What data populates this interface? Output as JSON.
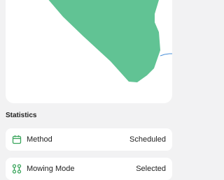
{
  "colors": {
    "mow_area": "#61c394",
    "accent_green": "#3aa55c",
    "path_blue": "#4a90d9",
    "card_bg": "#ffffff",
    "page_bg": "#f2f2f3"
  },
  "statistics": {
    "title": "Statistics",
    "items": [
      {
        "icon": "calendar-icon",
        "label": "Method",
        "value": "Scheduled"
      },
      {
        "icon": "mowing-mode-icon",
        "label": "Mowing Mode",
        "value": "Selected"
      }
    ]
  }
}
